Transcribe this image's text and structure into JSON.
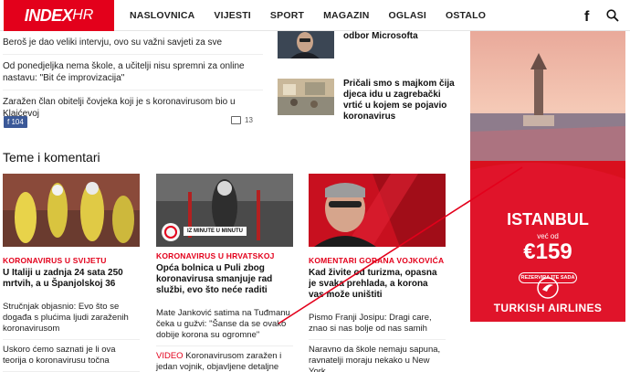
{
  "header": {
    "logo_mark": "INDEX",
    "logo_hr": "HR",
    "nav": [
      "NASLOVNICA",
      "VIJESTI",
      "SPORT",
      "MAGAZIN",
      "OGLASI",
      "OSTALO"
    ],
    "facebook_glyph": "f"
  },
  "left": {
    "items": [
      "Beroš je dao veliki intervju, ovo su važni savjeti za sve",
      "Od ponedjeljka nema škole, a učitelji nisu spremni za online nastavu: \"Bit će improvizacija\"",
      "Zaražen član obitelji čovjeka koji je s koronavirusom bio u Klaićevoj"
    ],
    "fb_count": "104",
    "comment_count": "13"
  },
  "middle_top": [
    {
      "title": "odbor Microsofta"
    },
    {
      "title": "Pričali smo s majkom čija djeca idu u zagrebački vrtić u kojem se pojavio koronavirus"
    }
  ],
  "section": {
    "title": "Teme i komentari",
    "cards": [
      {
        "category": "KORONAVIRUS U SVIJETU",
        "headline": "U Italiji u zadnja 24 sata 250 mrtvih, a u Španjolskoj 36",
        "subs": [
          {
            "text": "Stručnjak objasnio: Evo što se događa s plućima ljudi zaraženih koronavirusom"
          },
          {
            "text": "Uskoro ćemo saznati je li ova teorija o koronavirusu točna"
          }
        ]
      },
      {
        "category": "KORONAVIRUS U HRVATSKOJ",
        "badge": "IZ MINUTE U MINUTU",
        "headline": "Opća bolnica u Puli zbog koronavirusa smanjuje rad službi, evo što neće raditi",
        "subs": [
          {
            "text": "Mate Janković satima na Tuđmanu čeka u gužvi: \"Šanse da se ovako dobije korona su ogromne\""
          },
          {
            "video": "VIDEO",
            "text": " Koronavirusom zaražen i jedan vojnik, objavljene detaljne preporuke"
          }
        ]
      },
      {
        "category": "KOMENTARI GORANA VOJKOVIĆA",
        "headline": "Kad živite od turizma, opasna je svaka prehlada, a korona vas može uništiti",
        "subs": [
          {
            "text": "Pismo Franji Josipu: Dragi care, znao si nas bolje od nas samih"
          },
          {
            "text": "Naravno da škole nemaju sapuna, ravnatelji moraju nekako u New York"
          }
        ]
      }
    ]
  },
  "ad": {
    "city": "ISTANBUL",
    "from_label": "već od",
    "price": "€159",
    "cta": "REZERVIRAJTE SADA",
    "brand": "TURKISH AIRLINES"
  },
  "colors": {
    "brand_red": "#e3001b",
    "fb_blue": "#3b5998",
    "ad_red": "#d9101e"
  }
}
